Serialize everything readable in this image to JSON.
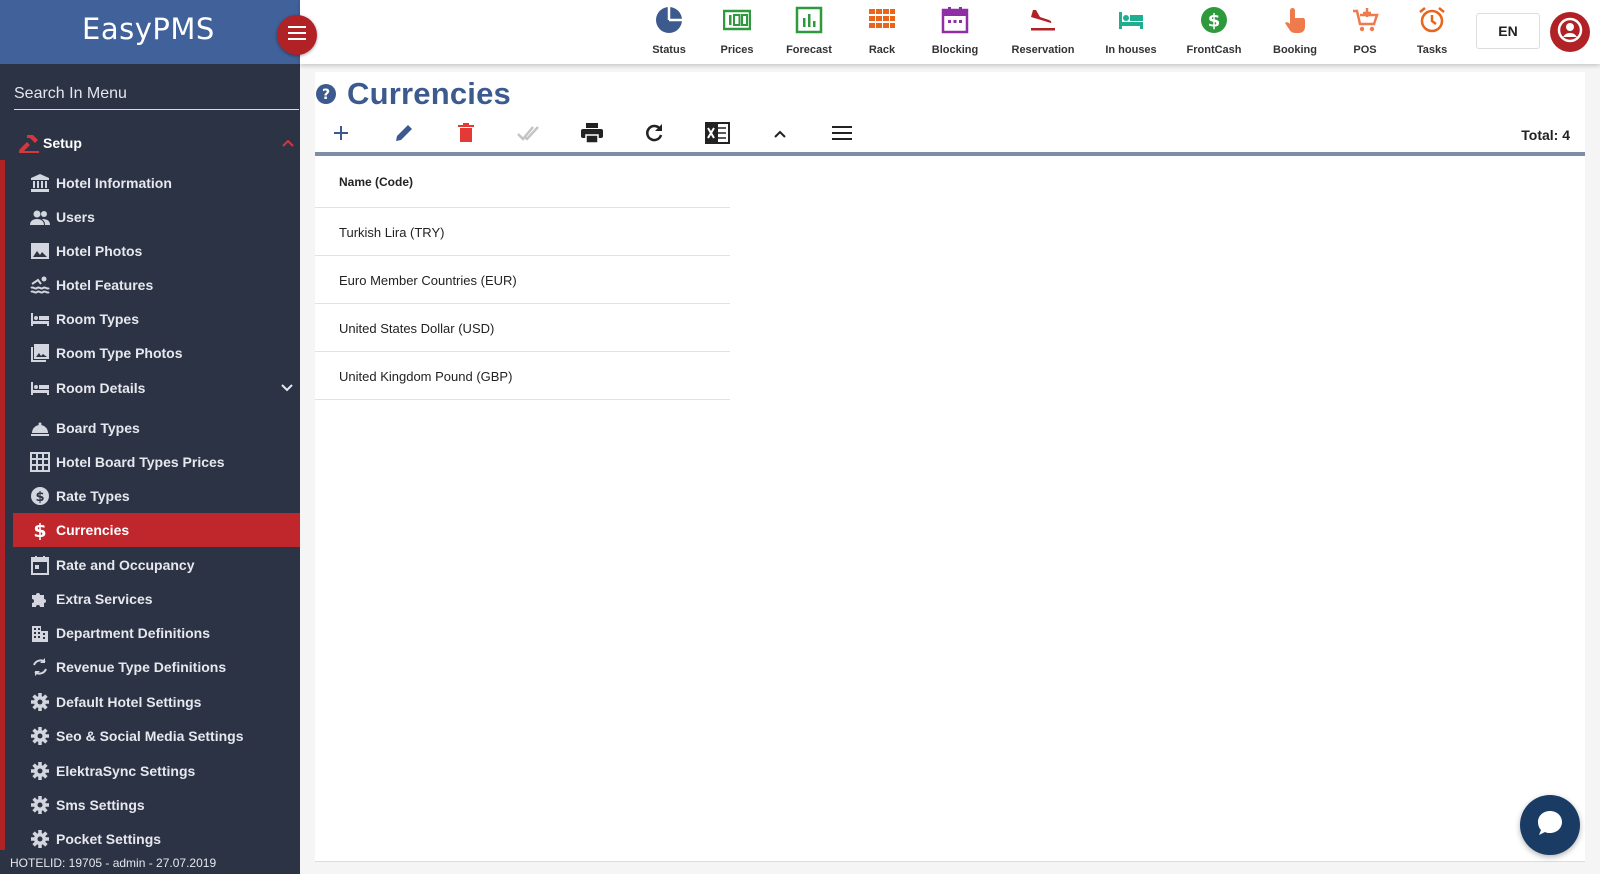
{
  "app": {
    "name": "EasyPMS"
  },
  "sidebar": {
    "search_placeholder": "Search In Menu",
    "section": "Setup",
    "items": [
      {
        "label": "Hotel Information",
        "icon": "bank-icon"
      },
      {
        "label": "Users",
        "icon": "users-icon"
      },
      {
        "label": "Hotel Photos",
        "icon": "image-icon"
      },
      {
        "label": "Hotel Features",
        "icon": "pool-icon"
      },
      {
        "label": "Room Types",
        "icon": "bed-icon"
      },
      {
        "label": "Room Type Photos",
        "icon": "photos-icon"
      },
      {
        "label": "Room Details",
        "icon": "bed-icon"
      },
      {
        "label": "Board Types",
        "icon": "cloche-icon"
      },
      {
        "label": "Hotel Board Types Prices",
        "icon": "grid-icon"
      },
      {
        "label": "Rate Types",
        "icon": "dollar-circle-icon"
      },
      {
        "label": "Currencies",
        "icon": "dollar-icon"
      },
      {
        "label": "Rate and Occupancy",
        "icon": "calendar-icon"
      },
      {
        "label": "Extra Services",
        "icon": "puzzle-icon"
      },
      {
        "label": "Department Definitions",
        "icon": "building-icon"
      },
      {
        "label": "Revenue Type Definitions",
        "icon": "sync-icon"
      },
      {
        "label": "Default Hotel Settings",
        "icon": "gear-icon"
      },
      {
        "label": "Seo & Social Media Settings",
        "icon": "gear-icon"
      },
      {
        "label": "ElektraSync Settings",
        "icon": "gear-icon"
      },
      {
        "label": "Sms Settings",
        "icon": "gear-icon"
      },
      {
        "label": "Pocket Settings",
        "icon": "gear-icon"
      }
    ],
    "footer": "HOTELID: 19705 - admin - 27.07.2019"
  },
  "topnav": [
    {
      "label": "Status",
      "icon": "pie-icon",
      "color": "#3d5a8f"
    },
    {
      "label": "Prices",
      "icon": "money-icon",
      "color": "#2e9a3c"
    },
    {
      "label": "Forecast",
      "icon": "chart-icon",
      "color": "#2e9a3c"
    },
    {
      "label": "Rack",
      "icon": "grid-icon",
      "color": "#e8651a"
    },
    {
      "label": "Blocking",
      "icon": "calendar-icon",
      "color": "#8e2fa6"
    },
    {
      "label": "Reservation",
      "icon": "plane-landing-icon",
      "color": "#b02226"
    },
    {
      "label": "In houses",
      "icon": "hotel-bed-icon",
      "color": "#1fae8f"
    },
    {
      "label": "FrontCash",
      "icon": "dollar-circle-icon",
      "color": "#2e9a3c"
    },
    {
      "label": "Booking",
      "icon": "touch-icon",
      "color": "#ef7a4c"
    },
    {
      "label": "POS",
      "icon": "cart-icon",
      "color": "#ef7a4c"
    },
    {
      "label": "Tasks",
      "icon": "alarm-icon",
      "color": "#e8651a"
    }
  ],
  "language": "EN",
  "page": {
    "title": "Currencies",
    "total": "Total: 4",
    "column": "Name (Code)",
    "rows": [
      "Turkish Lira (TRY)",
      "Euro Member Countries (EUR)",
      "United States Dollar (USD)",
      "United Kingdom Pound (GBP)"
    ]
  },
  "colors": {
    "brand": "#41619a",
    "accent": "#b02226",
    "sidebar": "#2c3344",
    "title": "#3d5a8f"
  }
}
